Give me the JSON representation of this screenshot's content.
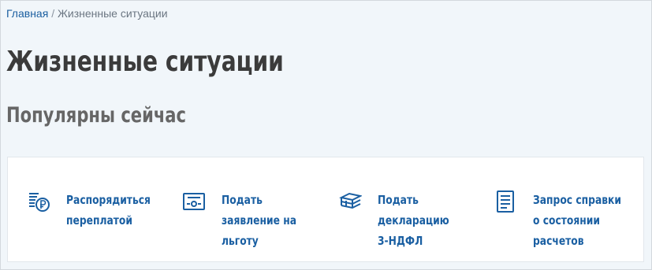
{
  "breadcrumb": {
    "home": "Главная",
    "separator": "/",
    "current": "Жизненные ситуации"
  },
  "page": {
    "title": "Жизненные ситуации",
    "section_title": "Популярны сейчас"
  },
  "colors": {
    "accent": "#1a5fa2",
    "background": "#f1f6fa",
    "title": "#3b3b3b",
    "subtitle": "#666666"
  },
  "cards": [
    {
      "icon": "coins-ruble-icon",
      "label": "Распорядиться переплатой"
    },
    {
      "icon": "certificate-icon",
      "label": "Подать заявление на льготу"
    },
    {
      "icon": "stacked-documents-icon",
      "label": "Подать декларацию 3-НДФЛ"
    },
    {
      "icon": "document-list-icon",
      "label": "Запрос справки о состоянии расчетов"
    }
  ]
}
